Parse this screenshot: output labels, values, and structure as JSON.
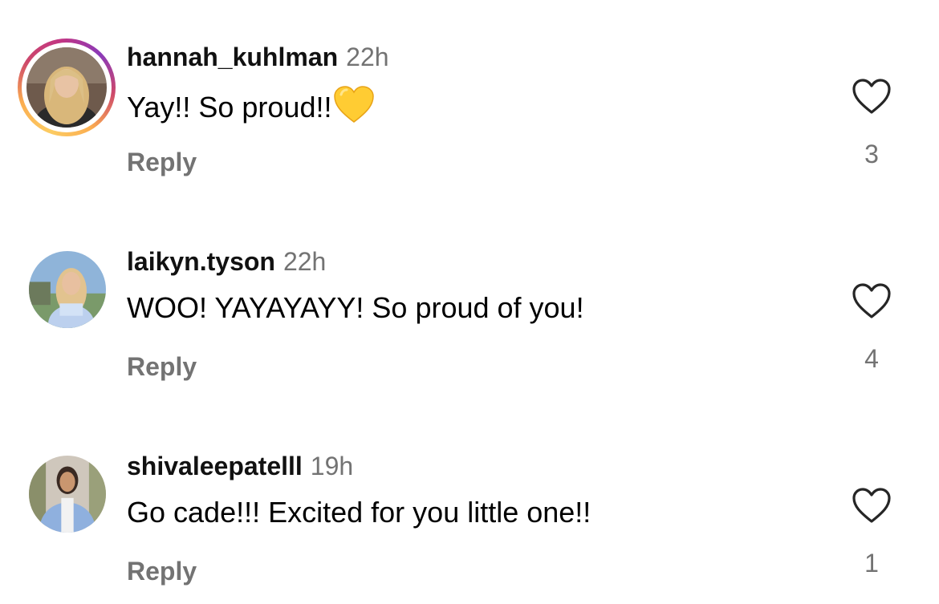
{
  "comments": [
    {
      "username": "hannah_kuhlman",
      "time": "22h",
      "text": "Yay!! So proud!!",
      "emoji": "yellow-heart",
      "reply_label": "Reply",
      "like_count": "3",
      "has_story": true
    },
    {
      "username": "laikyn.tyson",
      "time": "22h",
      "text": "WOO! YAYAYAYY! So proud of you!",
      "reply_label": "Reply",
      "like_count": "4",
      "has_story": false
    },
    {
      "username": "shivaleepatelll",
      "time": "19h",
      "text": "Go cade!!! Excited for you little one!!",
      "reply_label": "Reply",
      "like_count": "1",
      "has_story": false
    }
  ],
  "colors": {
    "meta_gray": "#737373",
    "emoji_yellow": "#FFCC33",
    "heart_outline": "#262626"
  },
  "icons": {
    "like": "heart-outline-icon",
    "emoji": "yellow-heart-emoji"
  }
}
